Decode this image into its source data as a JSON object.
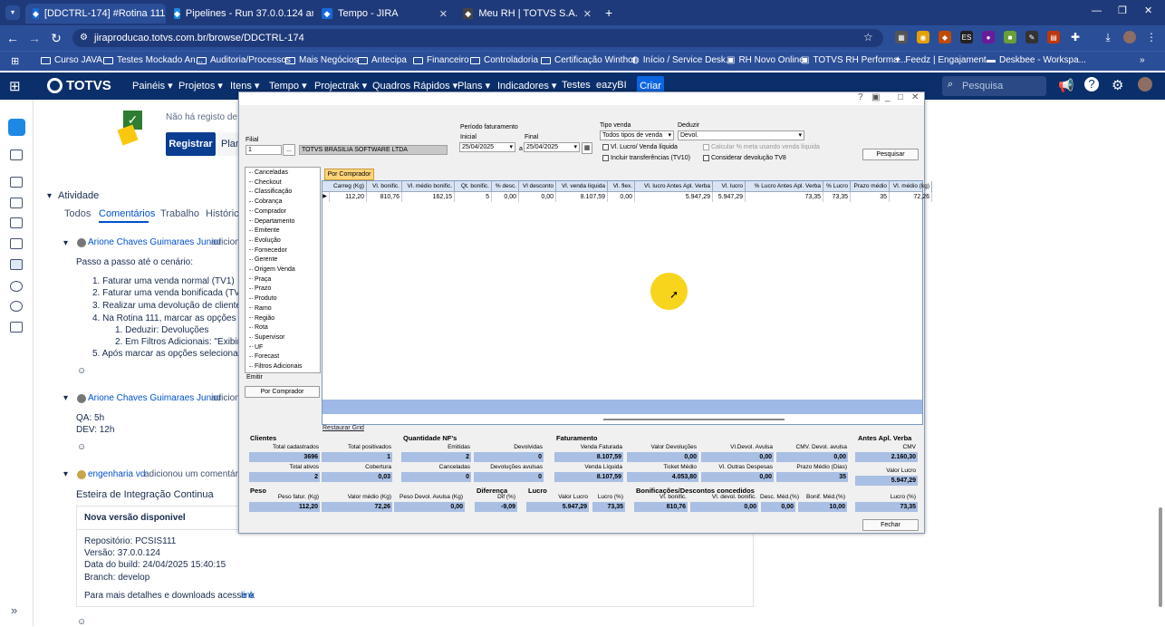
{
  "browser": {
    "tabs": [
      {
        "label": "[DDCTRL-174] #Rotina 111 - [C",
        "active": true,
        "icon_color": "#1868db"
      },
      {
        "label": "Pipelines - Run 37.0.0.124 artifa",
        "active": false,
        "icon_color": "#1e88e5"
      },
      {
        "label": "Tempo - JIRA",
        "active": false,
        "icon_color": "#1868db"
      },
      {
        "label": "Meu RH | TOTVS S.A.",
        "active": false,
        "icon_color": "#444"
      }
    ],
    "url": "jiraproducao.totvs.com.br/browse/DDCTRL-174",
    "bookmarks": [
      "Curso JAVA",
      "Testes Mockado An...",
      "Auditoria/Processos",
      "Mais Negócios",
      "Antecipa",
      "Financeiro",
      "Controladoria",
      "Certificação Winthor",
      "Início / Service Desk...",
      "RH Novo Online",
      "TOTVS RH Performa...",
      "Feedz | Engajament...",
      "Deskbee - Workspa..."
    ]
  },
  "jira": {
    "logo": "TOTVS",
    "nav": [
      "Painéis",
      "Projetos",
      "Itens",
      "Tempo",
      "Projectrak",
      "Quadros Rápidos",
      "Plans",
      "Indicadores",
      "Testes",
      "eazyBI"
    ],
    "create": "Criar",
    "search_placeholder": "Pesquisa",
    "no_record": "Não há registo de a",
    "register_button": "Registrar",
    "plan_button": "Plan",
    "activity": {
      "title": "Atividade",
      "tabs": [
        "Todos",
        "Comentários",
        "Trabalho",
        "Históric"
      ],
      "entries": [
        {
          "author": "Arione Chaves Guimaraes Junior",
          "action": "adicion"
        },
        {
          "author": "Arione Chaves Guimaraes Junior",
          "action": "adicion"
        },
        {
          "author": "engenharia vd",
          "action": "adicionou um comentário"
        }
      ],
      "steps_intro": "Passo a passo até o cenário:",
      "steps": [
        "1. Faturar uma venda normal (TV1)",
        "2. Faturar uma venda bonificada (TV5)",
        "3. Realizar uma devolução de cliente To",
        "4. Na Rotina 111, marcar as opções aba",
        "1. Deduzir: Devoluções",
        "2. Em Filtros Adicionais: \"Exibir va",
        "5. Após marcar as opções selecionadas,"
      ],
      "qa": "QA: 5h",
      "dev": "DEV: 12h",
      "ci_title": "Esteira de Integração Continua",
      "ci_card_title": "Nova versão disponivel",
      "ci_lines": [
        "Repositório: PCSIS111",
        "Versão: 37.0.0.124",
        "Data do build: 24/04/2025 15:40:15",
        "Branch: develop"
      ],
      "ci_more": "Para mais detalhes e downloads acesse o",
      "ci_link": "link"
    }
  },
  "window": {
    "filial_label": "Filial",
    "filial_value": "1",
    "filial_btn": "...",
    "company": "TOTVS BRASILIA SOFTWARE LTDA",
    "periodo_label": "Período faturamento",
    "inicial_label": "Inicial",
    "inicial_value": "25/04/2025",
    "a_label": "a",
    "final_label": "Final",
    "final_value": "25/04/2025",
    "tipo_venda_label": "Tipo venda",
    "tipo_venda_value": "Todos tipos de venda",
    "deduzir_label": "Deduzir",
    "deduzir_value": "Devol.",
    "check1": "Vl. Lucro/ Venda líquida",
    "check2": "Calcular % meta usando venda líquida",
    "check3": "Incluir transferências  (TV10)",
    "check4": "Considerar devolução TV8",
    "pesquisar": "Pesquisar",
    "tree": [
      "Canceladas",
      "Checkout",
      "Classificação",
      "Cobrança",
      "Comprador",
      "Departamento",
      "Emitente",
      "Evolução",
      "Fornecedor",
      "Gerente",
      "Origem Venda",
      "Praça",
      "Prazo",
      "Produto",
      "Ramo",
      "Região",
      "Rota",
      "Supervisor",
      "UF",
      "Forecast",
      "Filtros Adicionais"
    ],
    "emitir_label": "Emitir",
    "por_comprador_btn": "Por Comprador",
    "grid_tab": "Por Comprador",
    "grid_headers": [
      "Carreg (Kg)",
      "Vl. bonific.",
      "Vl. médio bonific.",
      "Qt. bonific.",
      "% desc.",
      "Vl desconto",
      "Vl. venda líquida",
      "Vl. flex.",
      "Vl. lucro Antes Apl. Verba",
      "Vl. lucro",
      "% Lucro Antes Apl. Verba",
      "% Lucro",
      "Prazo médio",
      "Vl. médio (kg)"
    ],
    "grid_row": [
      "112,20",
      "810,76",
      "162,15",
      "5",
      "0,00",
      "0,00",
      "8.107,59",
      "0,00",
      "5.947,29",
      "5.947,29",
      "73,35",
      "73,35",
      "35",
      "72,26"
    ],
    "restore_grid": "Restaurar Grid",
    "clientes": {
      "title": "Clientes",
      "total_cad_l": "Total cadastrados",
      "total_cad": "3696",
      "total_pos_l": "Total positivados",
      "total_pos": "1",
      "total_at_l": "Total ativos",
      "total_at": "2",
      "cobertura_l": "Cobertura",
      "cobertura": "0,03"
    },
    "qtd_nf": {
      "title": "Quantidade NF's",
      "emitidas_l": "Emitidas",
      "emitidas": "2",
      "devolvidas_l": "Devolvidas",
      "devolvidas": "0",
      "canceladas_l": "Canceladas",
      "canceladas": "0",
      "dev_avulsas_l": "Devoluções avulsas",
      "dev_avulsas": "0"
    },
    "fat": {
      "title": "Faturamento",
      "venda_fat_l": "Venda Faturada",
      "venda_fat": "8.107,59",
      "vl_dev_l": "Valor Devoluções",
      "vl_dev": "0,00",
      "vl_dev_av_l": "Vl.Devol. Avulsa",
      "vl_dev_av": "0,00",
      "cmv_dev_l": "CMV. Devol. avulsa",
      "cmv_dev": "0,00",
      "venda_liq_l": "Venda Líquida",
      "venda_liq": "8.107,59",
      "ticket_l": "Ticket Médio",
      "ticket": "4.053,80",
      "vl_outras_l": "Vl. Outras Despesas",
      "vl_outras": "0,00",
      "prazo_l": "Prazo Médio (Dias)",
      "prazo": "35"
    },
    "antes": {
      "title": "Antes Apl. Verba",
      "cmv_l": "CMV",
      "cmv": "2.160,30",
      "vl_lucro_l": "Valor Lucro",
      "vl_lucro": "5.947,29",
      "lucro_pct_l": "Lucro (%)",
      "lucro_pct": "73,35"
    },
    "peso": {
      "title": "Peso",
      "fatur_l": "Peso fatur. (Kg)",
      "fatur": "112,20",
      "medio_l": "Valor médio (Kg)",
      "medio": "72,26",
      "devol_l": "Peso Devol. Avulsa (Kg)",
      "devol": "0,00"
    },
    "diferenca": {
      "title": "Diferença",
      "dif_l": "Dif (%)",
      "dif": "-9,09"
    },
    "lucro": {
      "title": "Lucro",
      "valor_l": "Valor Lucro",
      "valor": "5.947,29",
      "pct_l": "Lucro (%)",
      "pct": "73,35"
    },
    "bonif": {
      "title": "Bonificações/Descontos concedidos",
      "vl_l": "Vl. bonific.",
      "vl": "810,76",
      "vl_dev_l": "Vl. devol. bonific.",
      "vl_dev": "0,00",
      "desc_l": "Desc. Méd.(%)",
      "desc": "0,00",
      "bonif_l": "Bonif. Méd.(%)",
      "bonif": "10,00"
    },
    "fechar": "Fechar"
  }
}
